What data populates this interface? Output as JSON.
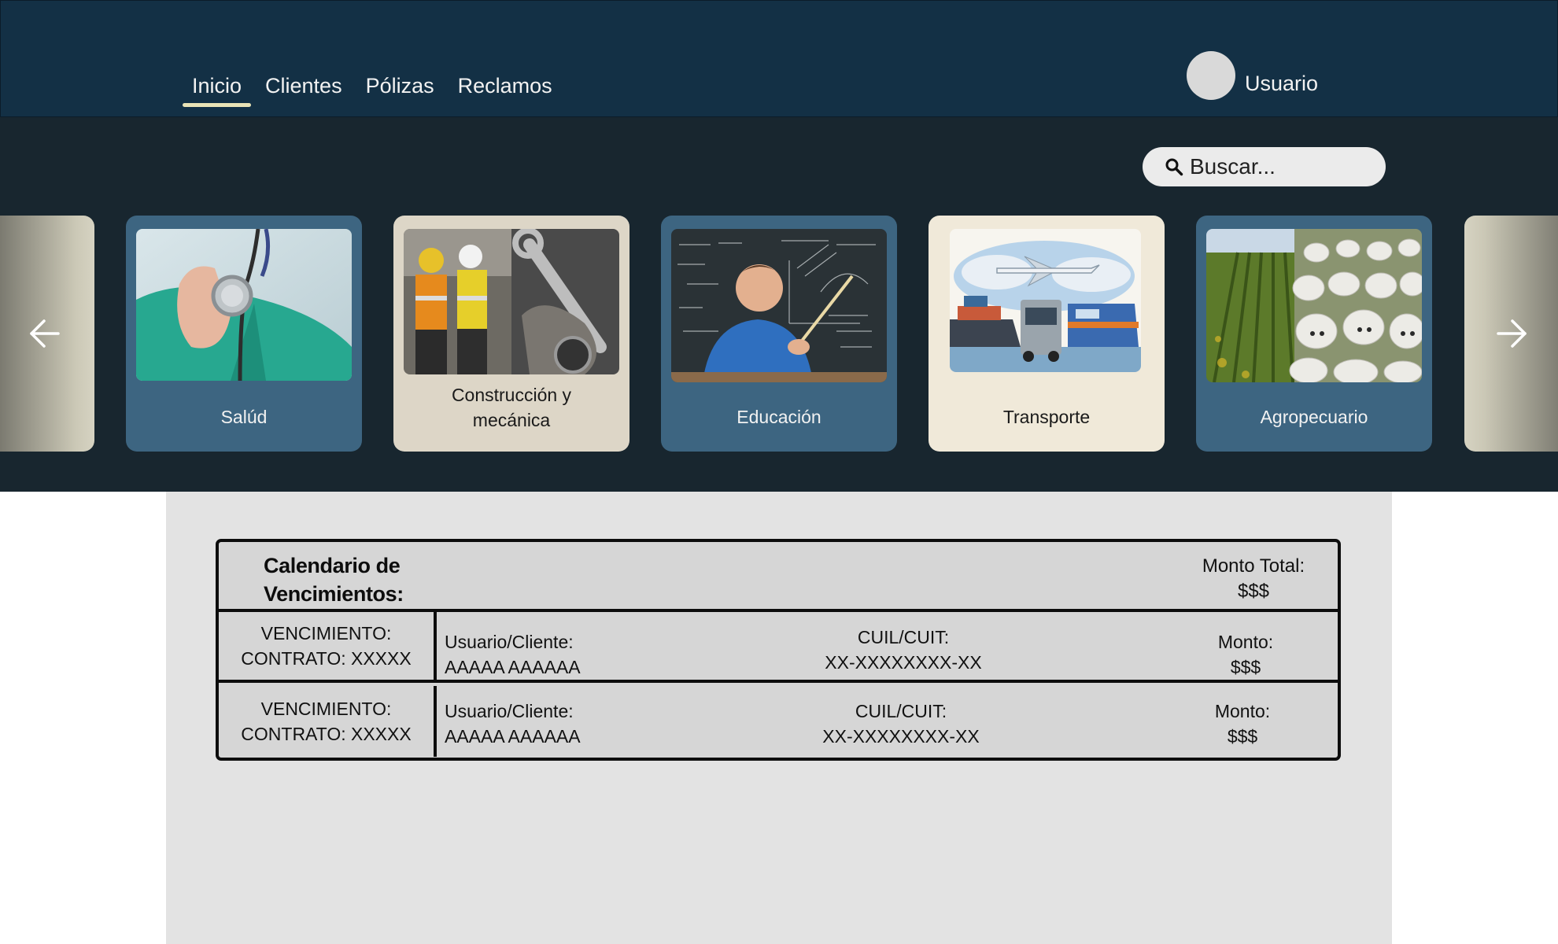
{
  "nav": {
    "items": [
      {
        "label": "Inicio",
        "active": true
      },
      {
        "label": "Clientes",
        "active": false
      },
      {
        "label": "Pólizas",
        "active": false
      },
      {
        "label": "Reclamos",
        "active": false
      }
    ]
  },
  "user": {
    "name": "Usuario",
    "avatar_icon": "user-avatar-placeholder"
  },
  "search": {
    "placeholder": "Buscar...",
    "icon": "search-icon"
  },
  "carousel": {
    "prev_icon": "arrow-left-icon",
    "next_icon": "arrow-right-icon",
    "cards": [
      {
        "label": "Salúd",
        "image": "doctor-stethoscope"
      },
      {
        "label": "Construcción y mecánica",
        "image": "construction-workers-wrench"
      },
      {
        "label": "Educación",
        "image": "teacher-blackboard"
      },
      {
        "label": "Transporte",
        "image": "plane-ship-truck-train"
      },
      {
        "label": "Agropecuario",
        "image": "vineyard-cattle"
      }
    ]
  },
  "calendar": {
    "title": "Calendario de Vencimientos:",
    "total_label": "Monto Total:",
    "total_value": "$$$",
    "rows": [
      {
        "venc_label": "VENCIMIENTO:",
        "contract": "CONTRATO: XXXXX",
        "user_label": "Usuario/Cliente:",
        "user_value": "AAAAA AAAAAA",
        "cuil_label": "CUIL/CUIT:",
        "cuil_value": "XX-XXXXXXXX-XX",
        "monto_label": "Monto:",
        "monto_value": "$$$"
      },
      {
        "venc_label": "VENCIMIENTO:",
        "contract": "CONTRATO: XXXXX",
        "user_label": "Usuario/Cliente:",
        "user_value": "AAAAA AAAAAA",
        "cuil_label": "CUIL/CUIT:",
        "cuil_value": "XX-XXXXXXXX-XX",
        "monto_label": "Monto:",
        "monto_value": "$$$"
      }
    ]
  },
  "colors": {
    "topbar": "#133045",
    "band": "#18262f",
    "card_blue": "#3d6581",
    "card_tan": "#ddd6c7",
    "card_cream": "#f0e9d9",
    "active_underline": "#e9e3b6",
    "content_bg": "#e3e3e3"
  }
}
